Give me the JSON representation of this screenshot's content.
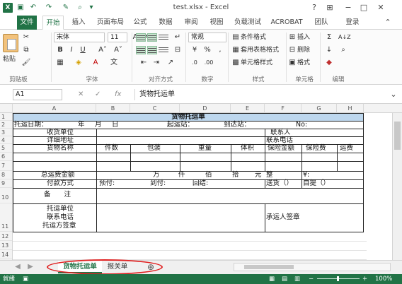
{
  "window": {
    "title": "test.xlsx - Excel",
    "help": "?",
    "restore_icon": "ribbon-display-icon",
    "minimize": "−",
    "maximize": "□",
    "close": "✕"
  },
  "quick_access": {
    "logo": "X",
    "save": "💾",
    "undo": "↶",
    "redo": "↷"
  },
  "ribbon_tabs": [
    "文件",
    "开始",
    "插入",
    "页面布局",
    "公式",
    "数据",
    "审阅",
    "视图",
    "负载测试",
    "ACROBAT",
    "团队",
    "登录"
  ],
  "active_tab": "开始",
  "ribbon": {
    "clipboard": {
      "paste": "粘贴",
      "label": "剪贴板"
    },
    "font": {
      "name": "宋体",
      "size": "11",
      "bold": "B",
      "italic": "I",
      "underline": "U",
      "grow": "A˄",
      "shrink": "A˅",
      "label": "字体"
    },
    "alignment": {
      "label": "对齐方式"
    },
    "number": {
      "format": "常规",
      "currency": "¥",
      "percent": "%",
      "comma": ",",
      "label": "数字"
    },
    "styles": {
      "conditional": "条件格式",
      "table": "套用表格格式",
      "cell": "单元格样式",
      "label": "样式"
    },
    "cells": {
      "insert": "插入",
      "delete": "删除",
      "format": "格式",
      "label": "单元格"
    },
    "editing": {
      "sum": "Σ",
      "sort": "A↓Z",
      "fill": "↓",
      "find": "🔍",
      "clear": "◆",
      "label": "编辑"
    }
  },
  "formula_bar": {
    "name_box": "A1",
    "cancel": "✕",
    "enter": "✓",
    "fx": "fx",
    "value": "货物托运单"
  },
  "columns": [
    "A",
    "B",
    "C",
    "D",
    "E",
    "F",
    "G",
    "H"
  ],
  "rows": [
    "1",
    "2",
    "3",
    "4",
    "5",
    "6",
    "7",
    "8",
    "9",
    "10",
    "11",
    "12",
    "13",
    "14"
  ],
  "form": {
    "title": "货物托运单",
    "r2": {
      "date": "托运日期：",
      "year": "年",
      "month": "月",
      "day": "日",
      "origin": "起运站：",
      "dest": "到达站：",
      "no": "No:"
    },
    "r3": {
      "shipper": "收货单位",
      "contact": "联系人"
    },
    "r4": {
      "address": "详细地址",
      "phone": "联系电话"
    },
    "r5": {
      "goods": "货物名称",
      "pieces": "件数",
      "packing": "包装",
      "weight": "重量",
      "volume": "体积",
      "insured": "保险金额",
      "premium": "保险费",
      "freight": "运费"
    },
    "r8": {
      "total": "总运费金额",
      "wan": "万",
      "qian": "仟",
      "bai": "佰",
      "shi": "拾",
      "yuan": "元",
      "zheng": "整",
      "yen": "¥:"
    },
    "r9": {
      "payment": "付款方式",
      "prepaid": "预付:",
      "cod": "到付:",
      "return": "回结:",
      "delivery": "送货（）",
      "pickup": "自提（）"
    },
    "r10": {
      "remarks": "备　　注"
    },
    "r11": {
      "shipper_unit": "托运单位",
      "shipper_phone": "联系电话",
      "shipper_sign": "托运方签章",
      "carrier_sign": "承运人签章"
    }
  },
  "sheets": [
    "货物托运单",
    "报关单"
  ],
  "add_sheet": "⊕",
  "status": {
    "mode": "就绪",
    "zoom": "100%"
  },
  "colors": {
    "accent": "#217346",
    "title_fill": "#bdd7ee",
    "annotation": "#e02020"
  }
}
